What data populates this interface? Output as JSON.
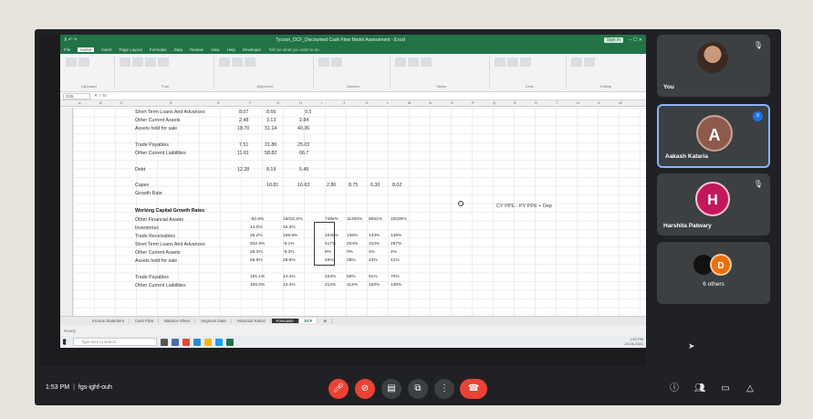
{
  "excel": {
    "title": "Tycoon_DCF_Discounted Cash Flow Model Assessment - Excel",
    "signin": "Sign in",
    "tabs": [
      "File",
      "Home",
      "Insert",
      "Page Layout",
      "Formulas",
      "Data",
      "Review",
      "View",
      "Help",
      "Developer"
    ],
    "active_tab": "Home",
    "tell_me": "Tell me what you want to do",
    "ribbon_groups": [
      "Clipboard",
      "Font",
      "Alignment",
      "Number",
      "Styles",
      "Cells",
      "Editing"
    ],
    "name_box": "G25",
    "rows": [
      {
        "label": "Short Term Loans And Advances",
        "v1": "8.07",
        "v2": "8.66",
        "v3": "9.5"
      },
      {
        "label": "Other Current Assets",
        "v1": "2.48",
        "v2": "3.13",
        "v3": "2.84"
      },
      {
        "label": "Assets held for sale",
        "v1": "18.70",
        "v2": "31.14",
        "v3": "40.36"
      },
      {
        "label": "Trade Payables",
        "v1": "7.51",
        "v2": "21.86",
        "v3": "25.03"
      },
      {
        "label": "Other Current Liabilities",
        "v1": "11.61",
        "v2": "58.82",
        "v3": "66.7"
      },
      {
        "label": "Debt",
        "v1": "12.28",
        "v2": "8.19",
        "v3": "5.45"
      }
    ],
    "capex": {
      "label": "Capex",
      "values": [
        "10.81",
        "16.63",
        "2.86",
        "8.75",
        "6.30",
        "8.02"
      ]
    },
    "growth_rate_label": "Growth Rate",
    "wc_header": "Working Capital Growth Rates",
    "wc_rows": [
      {
        "label": "Other Financial Assets",
        "values": [
          "-82.8%",
          "15031.0%",
          "7496%",
          "11260%",
          "8061%",
          "10039%"
        ]
      },
      {
        "label": "Inventories",
        "values": [
          "14.0%",
          "15.3%",
          "",
          "",
          "",
          ""
        ]
      },
      {
        "label": "Trade Receivables",
        "values": [
          "26.2%",
          "169.9%",
          "1039%",
          "136%",
          "133%",
          "139%"
        ]
      },
      {
        "label": "Short Term Loans And Advances",
        "values": [
          "842.9%",
          "-9.1%",
          "417%",
          "204%",
          "310%",
          "257%"
        ]
      },
      {
        "label": "Other Current Assets",
        "values": [
          "28.3%",
          "-9.3%",
          "8%",
          "0%",
          "4%",
          "2%"
        ]
      },
      {
        "label": "Assets held for sale",
        "values": [
          "66.5%",
          "29.6%",
          "46%",
          "38%",
          "43%",
          "41%"
        ]
      },
      {
        "label": "Trade Payables",
        "values": [
          "191.1%",
          "14.4%",
          "103%",
          "59%",
          "81%",
          "70%"
        ]
      },
      {
        "label": "Other Current Liabilities",
        "values": [
          "406.6%",
          "13.4%",
          "212%",
          "112%",
          "163%",
          "138%"
        ]
      }
    ],
    "formula_note": "CY PPE - PY PPE + Dep",
    "sheets": [
      "Income Statement",
      "Cash Flow",
      "Balance Sheet",
      "Segment Data",
      "Historical Ratios",
      "Forecasts",
      "DCF"
    ],
    "active_sheet": "Forecasts",
    "status": "Ready",
    "taskbar_search": "Type here to search",
    "taskbar_time": "1:53 PM",
    "taskbar_date": "23-06-2021"
  },
  "participants": [
    {
      "name": "You",
      "type": "video"
    },
    {
      "name": "Aakash Kataria",
      "initial": "A",
      "color": "#8d5a4c",
      "speaking": true
    },
    {
      "name": "Harshita Patwary",
      "initial": "H",
      "color": "#c2185b"
    },
    {
      "name": "6 others",
      "initial": "D",
      "color": "#e8710a"
    }
  ],
  "meeting": {
    "time": "1:53 PM",
    "code": "fgs-ighf-ouh"
  }
}
